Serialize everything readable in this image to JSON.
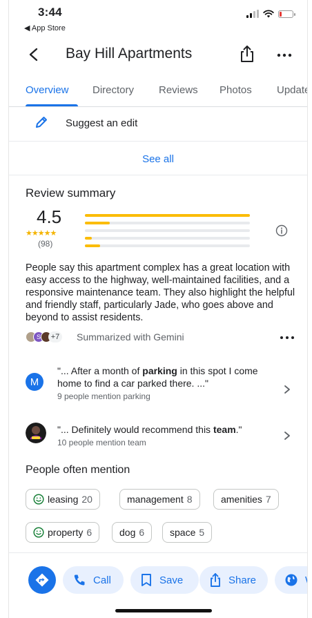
{
  "status_bar": {
    "time": "3:44",
    "back_app": "◀ App Store",
    "battery_color": "#e53935"
  },
  "header": {
    "title": "Bay Hill Apartments",
    "back_icon": "back-arrow-icon",
    "share_icon": "share-icon",
    "more_icon": "more-horizontal-icon"
  },
  "tabs": [
    {
      "label": "Overview",
      "active": true
    },
    {
      "label": "Directory",
      "active": false
    },
    {
      "label": "Reviews",
      "active": false
    },
    {
      "label": "Photos",
      "active": false
    },
    {
      "label": "Update",
      "active": false
    }
  ],
  "suggest_edit": {
    "label": "Suggest an edit",
    "icon": "pencil-icon"
  },
  "see_all": "See all",
  "review_summary": {
    "title": "Review summary",
    "rating": "4.5",
    "stars": "★★★★★",
    "count": "(98)",
    "distribution": [
      {
        "stars": 5,
        "fraction": 1.0
      },
      {
        "stars": 4,
        "fraction": 0.15
      },
      {
        "stars": 3,
        "fraction": 0.0
      },
      {
        "stars": 2,
        "fraction": 0.04
      },
      {
        "stars": 1,
        "fraction": 0.09
      }
    ],
    "summary_text": "People say this apartment complex has a great location with easy access to the highway, well-maintained facilities, and a responsive maintenance team. They also highlight the helpful and friendly staff, particularly Jade, who goes above and beyond to assist residents.",
    "avatars_extra": "+7",
    "gemini_label": "Summarized with Gemini"
  },
  "mentions": [
    {
      "avatar_letter": "M",
      "quote_before": "\"... After a month of ",
      "quote_bold": "parking",
      "quote_after": " in this spot I come home to find a car parked there. ...\"",
      "sub": "9 people mention parking"
    },
    {
      "avatar_letter": "",
      "quote_before": "\"... Definitely would recommend this ",
      "quote_bold": "team",
      "quote_after": ".\"",
      "sub": "10 people mention team"
    }
  ],
  "people_often_mention": {
    "title": "People often mention",
    "chips": [
      {
        "label": "leasing",
        "count": "20",
        "positive": true
      },
      {
        "label": "management",
        "count": "8",
        "positive": false
      },
      {
        "label": "amenities",
        "count": "7",
        "positive": false
      },
      {
        "label": "property",
        "count": "6",
        "positive": true
      },
      {
        "label": "dog",
        "count": "6",
        "positive": false
      },
      {
        "label": "space",
        "count": "5",
        "positive": false
      }
    ]
  },
  "action_bar": {
    "directions_icon": "directions-icon",
    "call": "Call",
    "save": "Save",
    "share": "Share",
    "website_partial": "W"
  },
  "colors": {
    "accent": "#1a73e8",
    "star": "#fbbc04",
    "pill_bg": "#e8f0fe",
    "positive": "#188038"
  }
}
